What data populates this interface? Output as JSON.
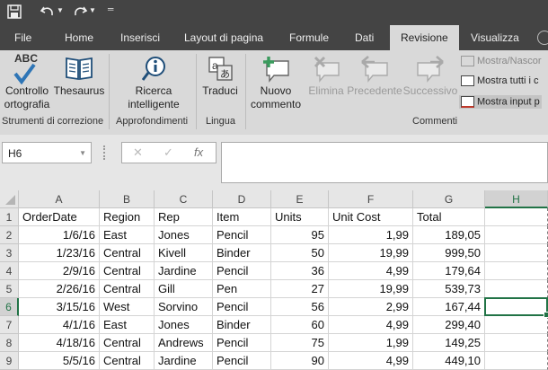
{
  "quick_access": {
    "icons": [
      "save-icon",
      "undo-icon",
      "redo-icon",
      "customize-qat-icon"
    ]
  },
  "tabs": [
    {
      "label": "File"
    },
    {
      "label": "Home"
    },
    {
      "label": "Inserisci"
    },
    {
      "label": "Layout di pagina"
    },
    {
      "label": "Formule"
    },
    {
      "label": "Dati"
    },
    {
      "label": "Revisione",
      "active": true
    },
    {
      "label": "Visualizza"
    }
  ],
  "ribbon": {
    "groups": [
      {
        "label": "Strumenti di correzione",
        "buttons": [
          {
            "label": "Controllo ortografia",
            "line1": "Controllo",
            "line2": "ortografia",
            "icon": "spelling-icon",
            "icon_text": "ABC"
          },
          {
            "label": "Thesaurus",
            "icon": "thesaurus-icon"
          }
        ]
      },
      {
        "label": "Approfondimenti",
        "buttons": [
          {
            "label": "Ricerca intelligente",
            "line1": "Ricerca",
            "line2": "intelligente",
            "icon": "smart-lookup-icon"
          }
        ]
      },
      {
        "label": "Lingua",
        "buttons": [
          {
            "label": "Traduci",
            "icon": "translate-icon"
          }
        ]
      },
      {
        "label": "Commenti",
        "buttons": [
          {
            "label": "Nuovo commento",
            "line1": "Nuovo",
            "line2": "commento",
            "icon": "new-comment-icon",
            "enabled": true
          },
          {
            "label": "Elimina",
            "icon": "delete-comment-icon",
            "enabled": false
          },
          {
            "label": "Precedente",
            "icon": "previous-comment-icon",
            "enabled": false
          },
          {
            "label": "Successivo",
            "icon": "next-comment-icon",
            "enabled": false
          }
        ],
        "small_items": [
          {
            "label": "Mostra/Nascor",
            "icon": "show-hide-comment-icon",
            "enabled": false
          },
          {
            "label": "Mostra tutti i c",
            "icon": "show-all-comments-icon",
            "enabled": true
          },
          {
            "label": "Mostra input p",
            "icon": "show-ink-icon",
            "enabled": true
          }
        ]
      }
    ]
  },
  "formula_bar": {
    "name_box": "H6",
    "cancel_glyph": "✕",
    "enter_glyph": "✓",
    "fx_label": "fx",
    "value": ""
  },
  "sheet": {
    "columns": [
      "A",
      "B",
      "C",
      "D",
      "E",
      "F",
      "G",
      "H"
    ],
    "selected_column": "H",
    "selected_row": "6",
    "selected_cell": "H6",
    "rows": [
      {
        "num": "1",
        "cells": [
          "OrderDate",
          "Region",
          "Rep",
          "Item",
          "Units",
          "Unit Cost",
          "Total",
          ""
        ]
      },
      {
        "num": "2",
        "cells": [
          "1/6/16",
          "East",
          "Jones",
          "Pencil",
          "95",
          "1,99",
          "189,05",
          ""
        ]
      },
      {
        "num": "3",
        "cells": [
          "1/23/16",
          "Central",
          "Kivell",
          "Binder",
          "50",
          "19,99",
          "999,50",
          ""
        ]
      },
      {
        "num": "4",
        "cells": [
          "2/9/16",
          "Central",
          "Jardine",
          "Pencil",
          "36",
          "4,99",
          "179,64",
          ""
        ]
      },
      {
        "num": "5",
        "cells": [
          "2/26/16",
          "Central",
          "Gill",
          "Pen",
          "27",
          "19,99",
          "539,73",
          ""
        ]
      },
      {
        "num": "6",
        "cells": [
          "3/15/16",
          "West",
          "Sorvino",
          "Pencil",
          "56",
          "2,99",
          "167,44",
          ""
        ]
      },
      {
        "num": "7",
        "cells": [
          "4/1/16",
          "East",
          "Jones",
          "Binder",
          "60",
          "4,99",
          "299,40",
          ""
        ]
      },
      {
        "num": "8",
        "cells": [
          "4/18/16",
          "Central",
          "Andrews",
          "Pencil",
          "75",
          "1,99",
          "149,25",
          ""
        ]
      },
      {
        "num": "9",
        "cells": [
          "5/5/16",
          "Central",
          "Jardine",
          "Pencil",
          "90",
          "4,99",
          "449,10",
          ""
        ]
      }
    ]
  },
  "colors": {
    "chrome_dark": "#444444",
    "ribbon_bg": "#d9d9d9",
    "selection_green": "#217346"
  }
}
